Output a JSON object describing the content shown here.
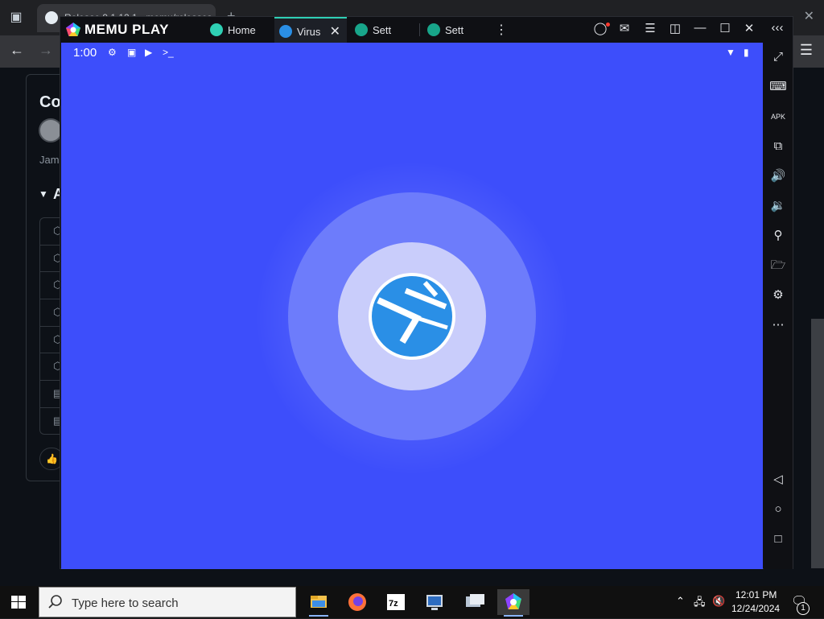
{
  "browser": {
    "tab_title": "Release 9.1.12.1 · memu/releases",
    "article_title": "Co",
    "author": "Jam",
    "section_heading": "A"
  },
  "memu": {
    "brand": "MEMU PLAY",
    "tabs": [
      {
        "label": "Home"
      },
      {
        "label": "Virus"
      },
      {
        "label": "Sett"
      },
      {
        "label": "Sett"
      }
    ]
  },
  "android": {
    "time": "1:00",
    "background_color": "#3d4efb"
  },
  "taskbar": {
    "search_placeholder": "Type here to search",
    "time": "12:01 PM",
    "date": "12/24/2024",
    "notification_count": "1"
  },
  "colors": {
    "memu_accent": "#2fd0b4",
    "android_bg": "#3d4efb",
    "logo_blue": "#2a8fe6"
  },
  "icons": {
    "sidebar": [
      "collapse-icon",
      "fullscreen-icon",
      "keyboard-icon",
      "apk-icon",
      "multi-window-icon",
      "volume-up-icon",
      "volume-down-icon",
      "location-icon",
      "folder-icon",
      "settings-icon",
      "more-icon",
      "back-icon",
      "home-icon",
      "recents-icon"
    ]
  }
}
